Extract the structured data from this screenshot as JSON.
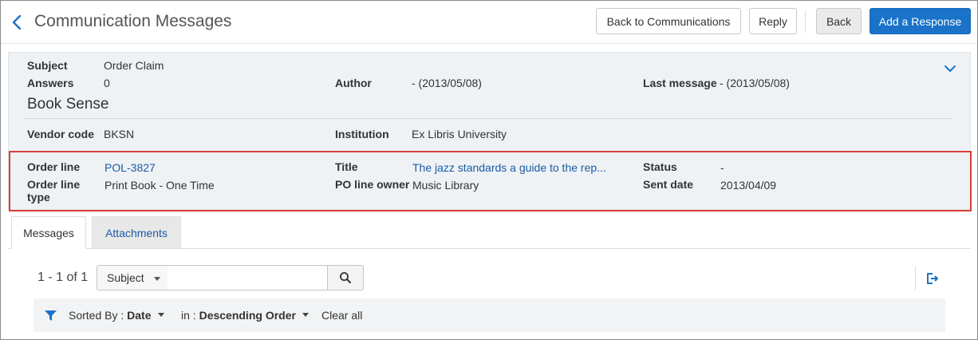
{
  "header": {
    "title": "Communication Messages",
    "buttons": {
      "back_to_communications": "Back to Communications",
      "reply": "Reply",
      "back": "Back",
      "add_response": "Add a Response"
    }
  },
  "summary": {
    "subject_label": "Subject",
    "subject_value": "Order Claim",
    "answers_label": "Answers",
    "answers_value": "0",
    "author_label": "Author",
    "author_value": "- (2013/05/08)",
    "last_message_label": "Last message",
    "last_message_value": "- (2013/05/08)",
    "vendor_name": "Book Sense",
    "vendor_code_label": "Vendor code",
    "vendor_code_value": "BKSN",
    "institution_label": "Institution",
    "institution_value": "Ex Libris University"
  },
  "order_line": {
    "order_line_label": "Order line",
    "order_line_value": "POL-3827",
    "order_line_type_label_1": "Order line",
    "order_line_type_label_2": "type",
    "order_line_type_value": "Print Book - One Time",
    "title_label": "Title",
    "title_value": "The jazz standards a guide to the rep...",
    "po_line_owner_label": "PO line owner",
    "po_line_owner_value": "Music Library",
    "status_label": "Status",
    "status_value": "-",
    "sent_date_label": "Sent date",
    "sent_date_value": "2013/04/09"
  },
  "tabs": [
    {
      "label": "Messages",
      "active": true
    },
    {
      "label": "Attachments",
      "active": false
    }
  ],
  "list": {
    "count": "1 - 1 of 1",
    "search_field": "Subject",
    "search_value": "",
    "sorted_by_label": "Sorted By :",
    "sorted_by_value": "Date",
    "order_label": "in :",
    "order_value": "Descending Order",
    "clear_all": "Clear all"
  },
  "colors": {
    "accent": "#1a73c9",
    "link": "#1c5aa6",
    "highlight_border": "#d9403a"
  }
}
